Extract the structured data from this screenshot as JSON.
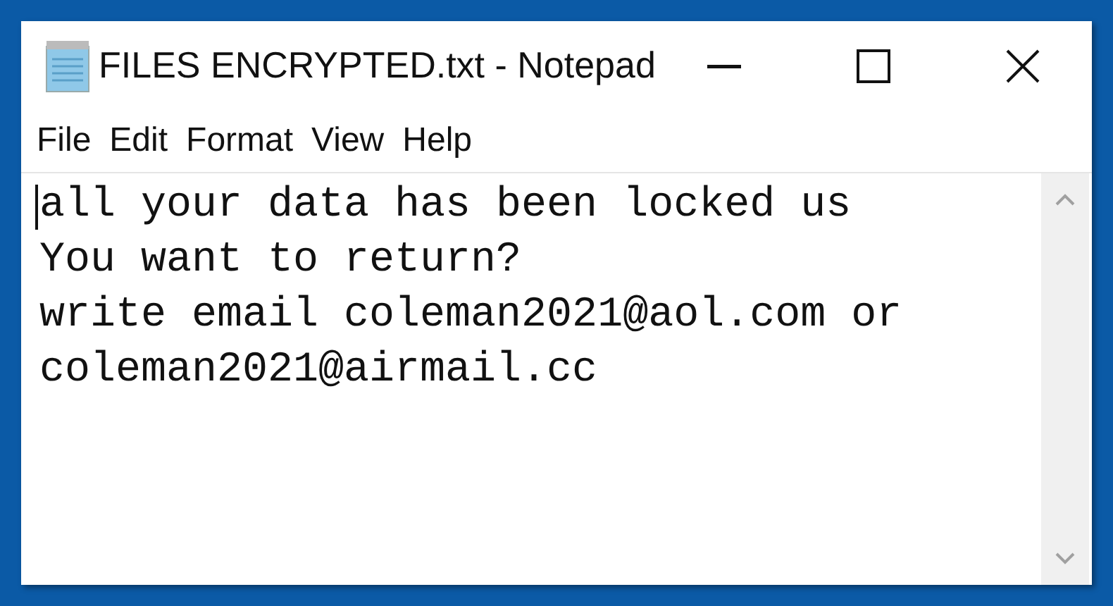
{
  "window": {
    "title": "FILES ENCRYPTED.txt - Notepad"
  },
  "menu": [
    {
      "label": "File"
    },
    {
      "label": "Edit"
    },
    {
      "label": "Format"
    },
    {
      "label": "View"
    },
    {
      "label": "Help"
    }
  ],
  "editor": {
    "lines": [
      "all your data has been locked us",
      "You want to return?",
      "write email coleman2021@aol.com or",
      "coleman2021@airmail.cc"
    ]
  }
}
